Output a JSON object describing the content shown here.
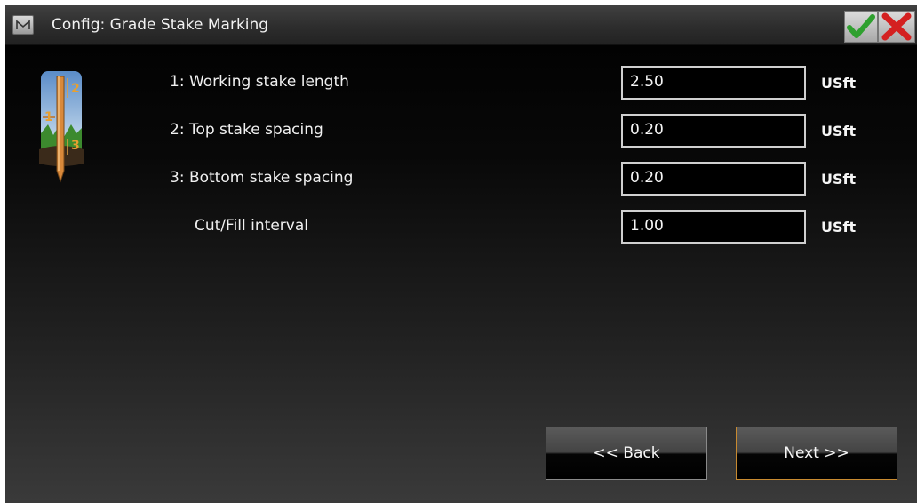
{
  "window": {
    "title": "Config: Grade Stake Marking",
    "menu_icon": "menu-icon",
    "ok_icon": "checkmark-icon",
    "cancel_icon": "close-icon"
  },
  "graphic": {
    "icon": "grade-stake-icon",
    "markers": [
      "1",
      "2",
      "3"
    ]
  },
  "fields": [
    {
      "label": "1: Working stake length",
      "value": "2.50",
      "unit": "USft"
    },
    {
      "label": "2: Top stake spacing",
      "value": "0.20",
      "unit": "USft"
    },
    {
      "label": "3: Bottom stake spacing",
      "value": "0.20",
      "unit": "USft"
    },
    {
      "label": "Cut/Fill interval",
      "value": "1.00",
      "unit": "USft"
    }
  ],
  "buttons": {
    "back_label": "<< Back",
    "next_label": "Next >>"
  },
  "colors": {
    "background": "#000000",
    "titlebar": "#2d2d2d",
    "ok_green": "#2fa02f",
    "cancel_red": "#d42020",
    "next_border": "#c88a30",
    "stake_orange": "#d9893a"
  }
}
